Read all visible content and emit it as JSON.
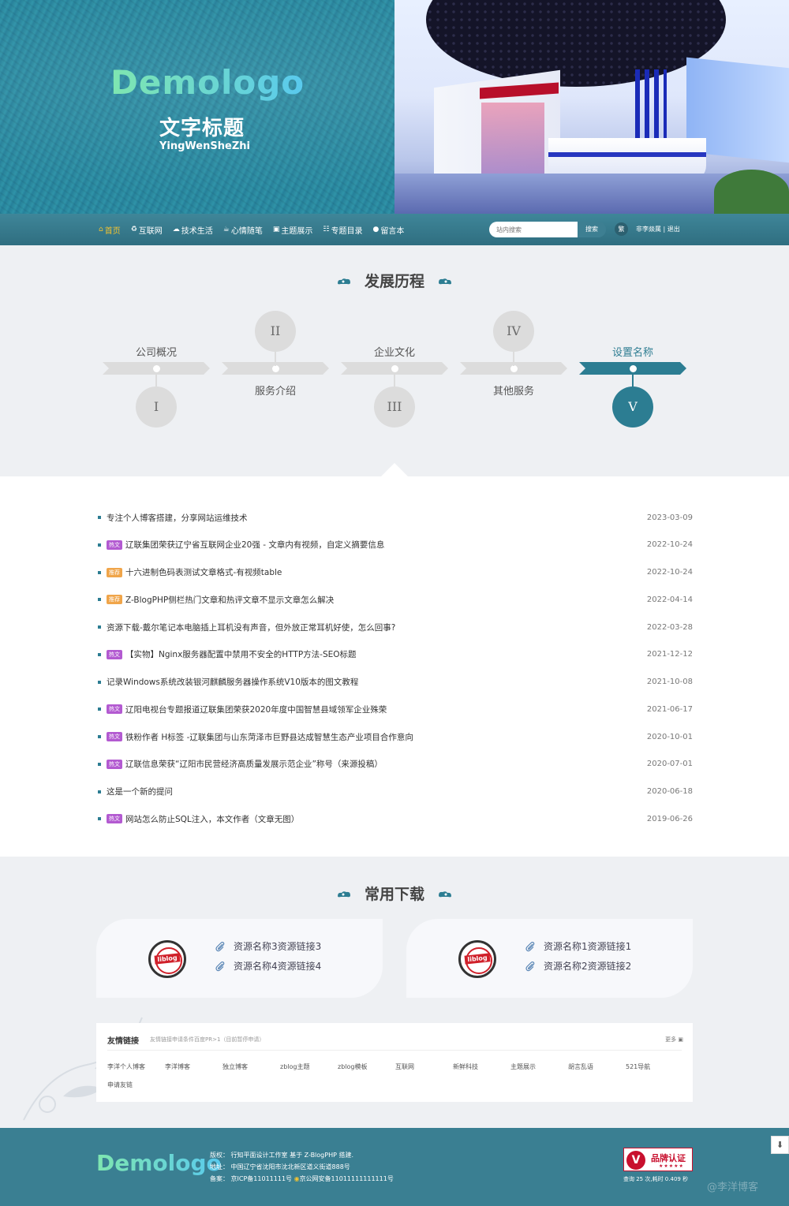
{
  "header": {
    "logo": "Demologo",
    "title": "文字标题",
    "subtitle": "YingWenSheZhi"
  },
  "nav": {
    "items": [
      {
        "label": "首页",
        "icon": "home-icon"
      },
      {
        "label": "互联网",
        "icon": "recycle-icon"
      },
      {
        "label": "技术生活",
        "icon": "cloud-icon"
      },
      {
        "label": "心情随笔",
        "icon": "coffee-icon"
      },
      {
        "label": "主题展示",
        "icon": "picture-icon"
      },
      {
        "label": "专题目录",
        "icon": "sitemap-icon"
      },
      {
        "label": "留言本",
        "icon": "comment-icon"
      }
    ],
    "active_index": 0,
    "search_placeholder": "站内搜索",
    "search_button": "搜索",
    "traditional": "繁",
    "user": "非李燚属",
    "separator": "|",
    "logout": "退出"
  },
  "timeline": {
    "title": "发展历程",
    "steps": [
      {
        "label": "公司概况",
        "numeral": "I"
      },
      {
        "label": "服务介绍",
        "numeral": "II"
      },
      {
        "label": "企业文化",
        "numeral": "III"
      },
      {
        "label": "其他服务",
        "numeral": "IV"
      },
      {
        "label": "设置名称",
        "numeral": "V"
      }
    ],
    "active_index": 4
  },
  "articles": [
    {
      "tag": "",
      "title": "专注个人博客搭建，分享网站运维技术",
      "date": "2023-03-09"
    },
    {
      "tag": "热文",
      "tag_type": "hot",
      "title": "辽联集团荣获辽宁省互联网企业20强 - 文章内有视频，自定义摘要信息",
      "date": "2022-10-24"
    },
    {
      "tag": "推荐",
      "tag_type": "rec",
      "title": "十六进制色码表测试文章格式-有视频table",
      "date": "2022-10-24"
    },
    {
      "tag": "推荐",
      "tag_type": "rec",
      "title": "Z-BlogPHP侧栏热门文章和热评文章不显示文章怎么解决",
      "date": "2022-04-14"
    },
    {
      "tag": "",
      "title": "资源下载-戴尔笔记本电脑插上耳机没有声音，但外放正常耳机好使，怎么回事?",
      "date": "2022-03-28"
    },
    {
      "tag": "热文",
      "tag_type": "hot",
      "title": "【实物】Nginx服务器配置中禁用不安全的HTTP方法-SEO标题",
      "date": "2021-12-12"
    },
    {
      "tag": "",
      "title": "记录Windows系统改装银河麒麟服务器操作系统V10版本的图文教程",
      "date": "2021-10-08"
    },
    {
      "tag": "热文",
      "tag_type": "hot",
      "title": "辽阳电视台专题报道辽联集团荣获2020年度中国智慧县域领军企业殊荣",
      "date": "2021-06-17"
    },
    {
      "tag": "热文",
      "tag_type": "hot",
      "title": "铁粉作者 H标签 -辽联集团与山东菏泽市巨野县达成智慧生态产业项目合作意向",
      "date": "2020-10-01"
    },
    {
      "tag": "热文",
      "tag_type": "hot",
      "title": "辽联信息荣获“辽阳市民营经济高质量发展示范企业”称号（来源投稿）",
      "date": "2020-07-01"
    },
    {
      "tag": "",
      "title": "这是一个新的提问",
      "date": "2020-06-18"
    },
    {
      "tag": "热文",
      "tag_type": "hot",
      "title": "网站怎么防止SQL注入，本文作者（文章无图）",
      "date": "2019-06-26"
    }
  ],
  "downloads": {
    "title": "常用下载",
    "cards": [
      {
        "logo": "liblog",
        "links": [
          "资源名称3资源链接3",
          "资源名称4资源链接4"
        ]
      },
      {
        "logo": "liblog",
        "links": [
          "资源名称1资源链接1",
          "资源名称2资源链接2"
        ]
      }
    ]
  },
  "friend_links": {
    "title": "友情链接",
    "note": "友情链接申请条件百度PR>1（目前暂停申请）",
    "more": "更多",
    "items": [
      "李洋个人博客",
      "李洋博客",
      "独立博客",
      "zblog主题",
      "zblog模板",
      "互联网",
      "新鲜科技",
      "主题展示",
      "胡言乱语",
      "521导航",
      "申请友链"
    ]
  },
  "footer": {
    "logo": "Demologo",
    "copyright": "版权：  行知平面设计工作室  基于 Z-BlogPHP 搭建.",
    "address": "地址：  中国辽宁省沈阳市沈北新区道义街道888号",
    "icp": "备案：  京ICP备11011111号",
    "police": "京公网安备11011111111111号",
    "badge_title": "品牌认证",
    "badge_stars": "★★★★★",
    "query": "查询 25 次,耗时 0.409 秒",
    "watermark": "@李洋博客"
  },
  "colors": {
    "primary": "#2c7d92",
    "nav_active": "#f2c230",
    "hot_tag": "#b35ad1",
    "rec_tag": "#f0a54a"
  }
}
